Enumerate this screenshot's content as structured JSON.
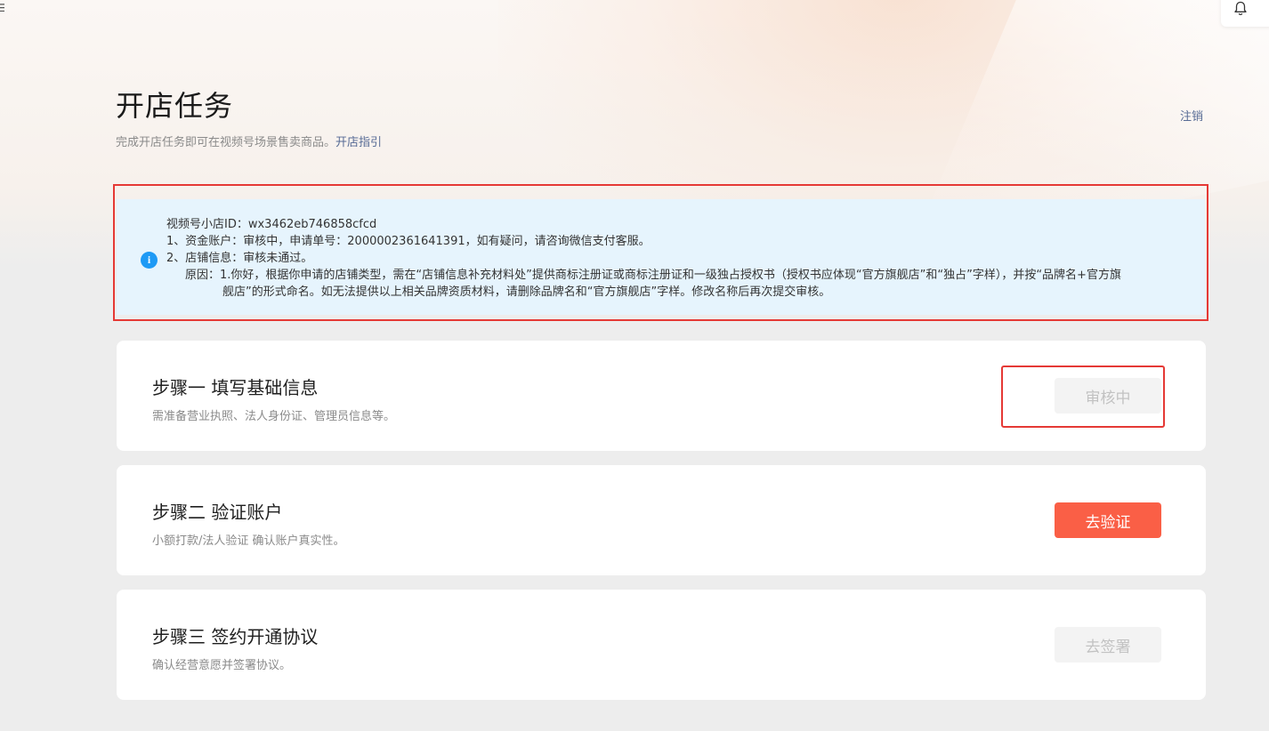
{
  "header": {
    "title": "开店任务",
    "subtitle": "完成开店任务即可在视频号场景售卖商品。",
    "guide_link": "开店指引",
    "logout_label": "注销",
    "bell_icon": "bell-icon"
  },
  "notice": {
    "icon": "info-icon",
    "icon_glyph": "i",
    "shop_id_line": "视频号小店ID：wx3462eb746858cfcd",
    "line1": "1、资金账户：审核中，申请单号：2000002361641391，如有疑问，请咨询微信支付客服。",
    "line2": "2、店铺信息：审核未通过。",
    "reason_line1": "原因：1.你好，根据你申请的店铺类型，需在“店铺信息补充材料处”提供商标注册证或商标注册证和一级独占授权书（授权书应体现“官方旗舰店”和“独占”字样），并按“品牌名+官方旗",
    "reason_line2": "舰店”的形式命名。如无法提供以上相关品牌资质材料，请删除品牌名和“官方旗舰店”字样。修改名称后再次提交审核。",
    "highlight_color": "#e53935"
  },
  "steps": [
    {
      "title": "步骤一  填写基础信息",
      "desc": "需准备营业执照、法人身份证、管理员信息等。",
      "button_label": "审核中",
      "button_state": "disabled"
    },
    {
      "title": "步骤二  验证账户",
      "desc": "小额打款/法人验证 确认账户真实性。",
      "button_label": "去验证",
      "button_state": "primary"
    },
    {
      "title": "步骤三  签约开通协议",
      "desc": "确认经营意愿并签署协议。",
      "button_label": "去签署",
      "button_state": "disabled"
    }
  ],
  "colors": {
    "primary_button": "#fa5f46",
    "link": "#576b95",
    "notice_bg": "#e6f4fd",
    "info_icon": "#1e9af5"
  }
}
